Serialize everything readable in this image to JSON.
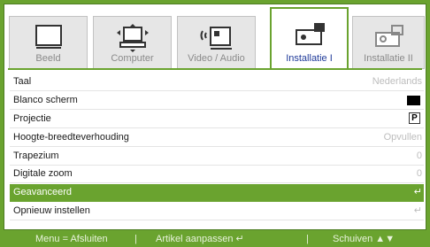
{
  "tabs": [
    {
      "label": "Beeld",
      "icon": "screen-icon",
      "active": false
    },
    {
      "label": "Computer",
      "icon": "computer-icon",
      "active": false
    },
    {
      "label": "Video / Audio",
      "icon": "video-audio-icon",
      "active": false
    },
    {
      "label": "Installatie I",
      "icon": "projector-icon",
      "active": true
    },
    {
      "label": "Installatie II",
      "icon": "projector-icon",
      "active": false
    }
  ],
  "menu": {
    "items": [
      {
        "label": "Taal",
        "value": "Nederlands"
      },
      {
        "label": "Blanco scherm",
        "value": "",
        "indicator": "black-square"
      },
      {
        "label": "Projectie",
        "value": "P",
        "indicator": "p-box"
      },
      {
        "label": "Hoogte-breedteverhouding",
        "value": "Opvullen"
      },
      {
        "label": "Trapezium",
        "value": "0"
      },
      {
        "label": "Digitale zoom",
        "value": "0"
      },
      {
        "label": "Geavanceerd",
        "value": "↵",
        "selected": true
      },
      {
        "label": "Opnieuw instellen",
        "value": "↵"
      }
    ]
  },
  "footer": {
    "menu_hint": "Menu = Afsluiten",
    "sep1": "|",
    "adjust_hint": "Artikel aanpassen ↵",
    "sep2": "|",
    "move_hint": "Schuiven ▲▼"
  },
  "colors": {
    "accent": "#6aa32f",
    "active_tab_text": "#1f3a99"
  }
}
